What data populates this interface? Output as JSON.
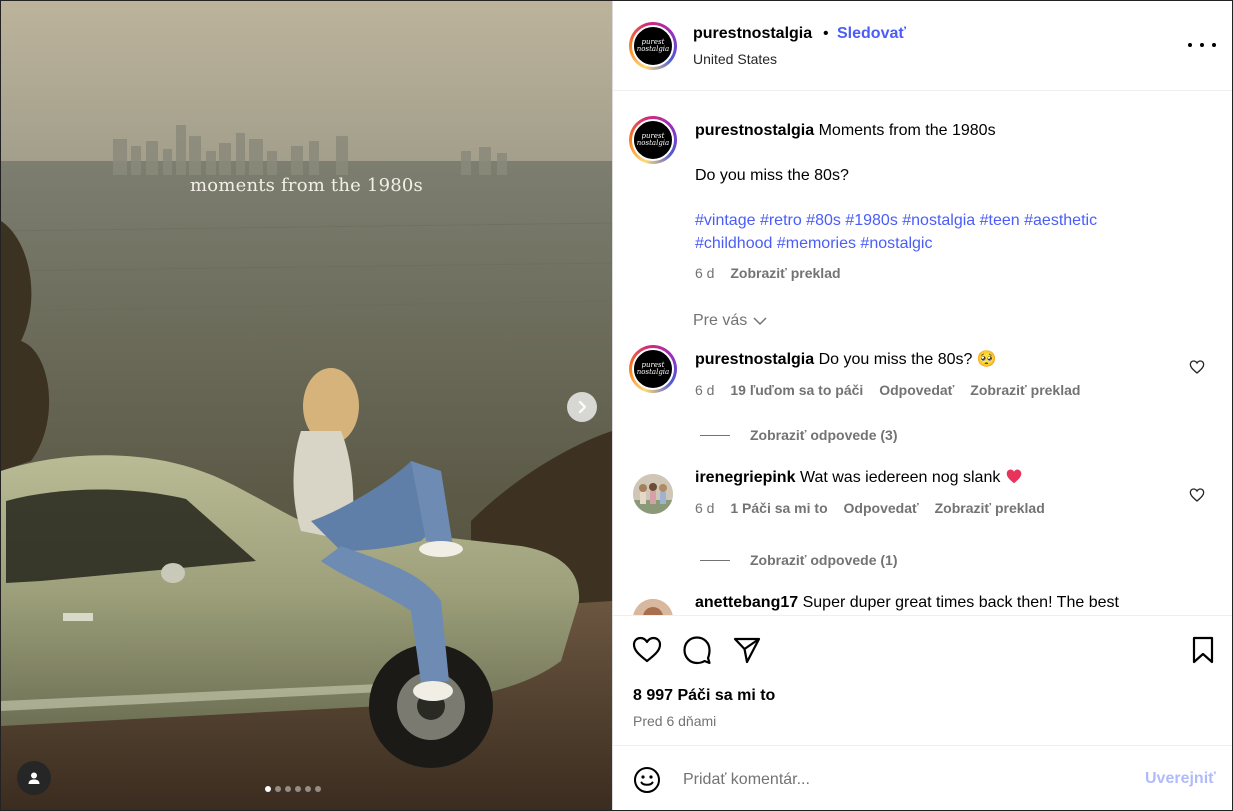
{
  "media": {
    "caption": "moments from the 1980s",
    "slide_count": 6,
    "active_slide": 1
  },
  "header": {
    "avatar_line1": "purest",
    "avatar_line2": "nostalgia",
    "username": "purestnostalgia",
    "separator": "•",
    "follow_label": "Sledovať",
    "location": "United States"
  },
  "post": {
    "username": "purestnostalgia",
    "caption": "Moments from the 1980s",
    "question": "Do you miss the 80s?",
    "hashtags_line1": "#vintage #retro #80s #1980s #nostalgia #teen #aesthetic",
    "hashtags_line2": "#childhood #memories #nostalgic",
    "age": "6 d",
    "translate": "Zobraziť preklad"
  },
  "filter": {
    "label": "Pre vás"
  },
  "comments": [
    {
      "username": "purestnostalgia",
      "text": "Do you miss the 80s? 🥺",
      "age": "6 d",
      "likes": "19 ľuďom sa to páči",
      "reply": "Odpovedať",
      "translate": "Zobraziť preklad",
      "replies": "Zobraziť odpovede (3)"
    },
    {
      "username": "irenegriepink",
      "text": "Wat was iedereen nog slank",
      "age": "6 d",
      "likes": "1 Páči sa mi to",
      "reply": "Odpovedať",
      "translate": "Zobraziť preklad",
      "replies": "Zobraziť odpovede (1)"
    },
    {
      "username": "anettebang17",
      "text": "Super duper great times back then! The best"
    }
  ],
  "footer": {
    "likes_count": "8 997 Páči sa mi to",
    "posted": "Pred 6 dňami",
    "comment_placeholder": "Pridať komentár...",
    "post_label": "Uverejniť"
  },
  "colors": {
    "link": "#4a5df9",
    "muted": "#737373",
    "post_disabled": "#b2bbfa",
    "heart_red": "#e8335a"
  }
}
